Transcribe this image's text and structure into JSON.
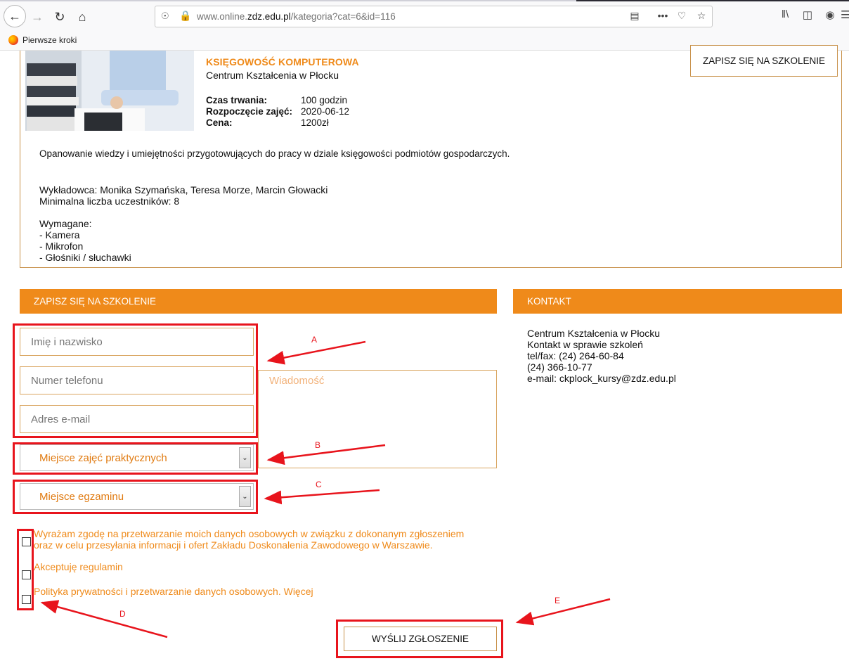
{
  "browser": {
    "url_prefix": "www.online.",
    "url_domain": "zdz.edu.pl",
    "url_path": "/kategoria?cat=6&id=116",
    "bookmark": "Pierwsze kroki"
  },
  "course": {
    "title": "KSIĘGOWOŚĆ KOMPUTEROWA",
    "center": "Centrum Kształcenia w Płocku",
    "duration_label": "Czas trwania:",
    "duration_value": "100 godzin",
    "start_label": "Rozpoczęcie zajęć:",
    "start_value": "2020-06-12",
    "price_label": "Cena:",
    "price_value": "1200zł",
    "signup_button": "ZAPISZ SIĘ NA SZKOLENIE",
    "description": "Opanowanie wiedzy i umiejętności przygotowujących do pracy w dziale księgowości podmiotów gospodarczych.",
    "lecturers": "Wykładowca: Monika Szymańska, Teresa Morze, Marcin Głowacki",
    "min_participants": "Minimalna liczba uczestników: 8",
    "required_label": "Wymagane:",
    "required_items": [
      "- Kamera",
      "- Mikrofon",
      "- Głośniki / słuchawki"
    ]
  },
  "form": {
    "header": "ZAPISZ SIĘ NA SZKOLENIE",
    "name_placeholder": "Imię i nazwisko",
    "phone_placeholder": "Numer telefonu",
    "email_placeholder": "Adres e-mail",
    "message_placeholder": "Wiadomość",
    "practice_select": "Miejsce zajęć praktycznych",
    "exam_select": "Miejsce egzaminu",
    "consent1_line1": "Wyrażam zgodę na przetwarzanie moich danych osobowych w związku z dokonanym zgłoszeniem",
    "consent1_line2": "oraz w celu przesyłania informacji i ofert Zakładu Doskonalenia Zawodowego w Warszawie.",
    "consent2": "Akceptuję regulamin",
    "consent3": "Polityka prywatności i przetwarzanie danych osobowych. Więcej",
    "submit": "WYŚLIJ ZGŁOSZENIE"
  },
  "contact": {
    "header": "KONTAKT",
    "lines": [
      "Centrum Kształcenia w Płocku",
      "Kontakt w sprawie szkoleń",
      "tel/fax: (24) 264-60-84",
      "(24) 366-10-77",
      "e-mail: ckplock_kursy@zdz.edu.pl"
    ]
  },
  "annotations": [
    "A",
    "B",
    "C",
    "D",
    "E"
  ],
  "colors": {
    "accent": "#ef8a1a",
    "annotation": "#e8141c"
  }
}
